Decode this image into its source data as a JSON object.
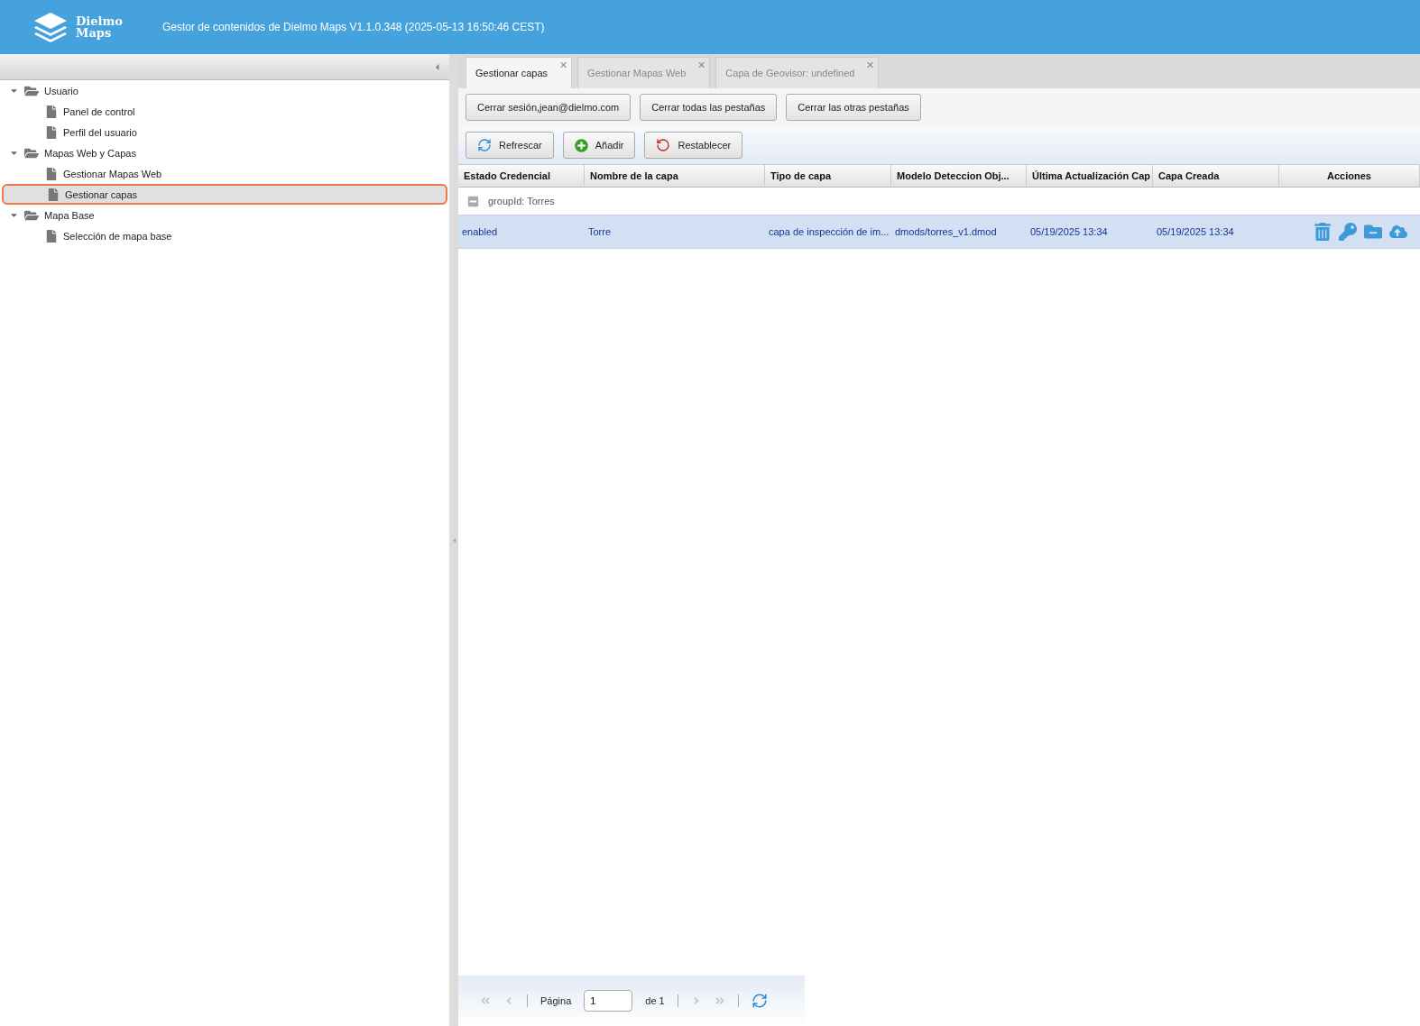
{
  "header": {
    "logo_line_1": "Dielmo",
    "logo_line_2": "Maps",
    "title": "Gestor de contenidos de Dielmo Maps V1.1.0.348 (2025-05-13 16:50:46 CEST)"
  },
  "tree": [
    {
      "label": "Usuario",
      "kind": "folder",
      "expanded": true,
      "selected": false,
      "children": [
        {
          "label": "Panel de control",
          "kind": "file",
          "selected": false
        },
        {
          "label": "Perfil del usuario",
          "kind": "file",
          "selected": false
        }
      ]
    },
    {
      "label": "Mapas Web y Capas",
      "kind": "folder",
      "expanded": true,
      "selected": false,
      "children": [
        {
          "label": "Gestionar Mapas Web",
          "kind": "file",
          "selected": false
        },
        {
          "label": "Gestionar capas",
          "kind": "file",
          "selected": true
        }
      ]
    },
    {
      "label": "Mapa Base",
      "kind": "folder",
      "expanded": true,
      "selected": false,
      "children": [
        {
          "label": "Selección de mapa base",
          "kind": "file",
          "selected": false
        }
      ]
    }
  ],
  "tabs": [
    {
      "label": "Gestionar capas",
      "selected": true,
      "close": "✕"
    },
    {
      "label": "Gestionar Mapas Web",
      "selected": false,
      "close": "✕"
    },
    {
      "label": "Capa de Geovisor: undefined",
      "selected": false,
      "close": "✕"
    }
  ],
  "session_buttons": [
    "Cerrar sesión,jean@dielmo.com",
    "Cerrar todas las pestañas",
    "Cerrar las otras pestañas"
  ],
  "toolbar": [
    {
      "label": "Refrescar",
      "kind": "refresh"
    },
    {
      "label": "Añadir",
      "kind": "add"
    },
    {
      "label": "Restablecer",
      "kind": "reset"
    }
  ],
  "table": {
    "columns": [
      "Estado Credencial",
      "Nombre de la capa",
      "Tipo de capa",
      "Modelo Deteccion Obj...",
      "Última Actualización Cap",
      "Capa Creada",
      "Acciones"
    ],
    "group": {
      "label": "groupId: Torres",
      "expanded": true
    },
    "rows": [
      {
        "cells": [
          "enabled",
          "Torre",
          "capa de inspección de im...",
          "dmods/torres_v1.dmod",
          "05/19/2025 13:34",
          "05/19/2025 13:34"
        ],
        "selected": true,
        "actions": [
          {
            "kind": "delete"
          },
          {
            "kind": "key"
          },
          {
            "kind": "folder"
          },
          {
            "kind": "upload"
          }
        ]
      }
    ]
  },
  "pager": {
    "label": "Página",
    "value": "1",
    "of": "de 1",
    "prev_disabled": true,
    "next_disabled": true
  }
}
